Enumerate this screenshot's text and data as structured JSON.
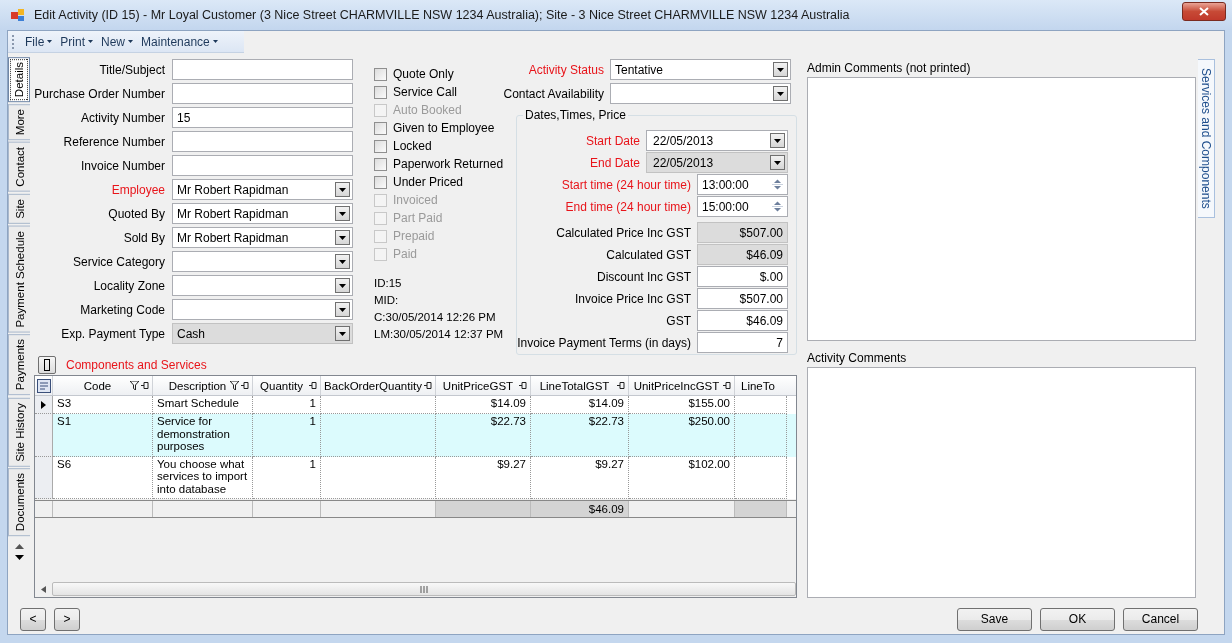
{
  "window": {
    "title": "Edit Activity (ID 15)  - Mr Loyal Customer (3 Nice Street CHARMVILLE  NSW 1234 Australia); Site - 3 Nice Street CHARMVILLE  NSW 1234 Australia"
  },
  "menu": [
    "File",
    "Print",
    "New",
    "Maintenance"
  ],
  "side_tabs": [
    {
      "label": "Details",
      "selected": true
    },
    {
      "label": "More",
      "selected": false
    },
    {
      "label": "Contact",
      "selected": false
    },
    {
      "label": "Site",
      "selected": false
    },
    {
      "label": "Payment Schedule",
      "selected": false
    },
    {
      "label": "Payments",
      "selected": false
    },
    {
      "label": "Site History",
      "selected": false
    },
    {
      "label": "Documents",
      "selected": false
    }
  ],
  "right_tabs": [
    {
      "label": "Services and Components",
      "selected": false
    }
  ],
  "form_fields": [
    {
      "label": "Title/Subject",
      "kind": "text",
      "required": false,
      "disabled": false
    },
    {
      "label": "Purchase Order Number",
      "kind": "text",
      "required": false,
      "disabled": false
    },
    {
      "label": "Activity Number",
      "kind": "text",
      "value": "15",
      "required": false,
      "disabled": false
    },
    {
      "label": "Reference Number",
      "kind": "text",
      "required": false,
      "disabled": false
    },
    {
      "label": "Invoice Number",
      "kind": "text",
      "required": false,
      "disabled": false
    },
    {
      "label": "Employee",
      "kind": "combo",
      "value": "Mr Robert Rapidman",
      "required": true,
      "disabled": false
    },
    {
      "label": "Quoted By",
      "kind": "combo",
      "value": "Mr Robert Rapidman",
      "required": false,
      "disabled": false
    },
    {
      "label": "Sold By",
      "kind": "combo",
      "value": "Mr Robert Rapidman",
      "required": false,
      "disabled": false
    },
    {
      "label": "Service Category",
      "kind": "combo",
      "required": false,
      "disabled": false
    },
    {
      "label": "Locality Zone",
      "kind": "combo",
      "required": false,
      "disabled": false
    },
    {
      "label": "Marketing Code",
      "kind": "combo",
      "required": false,
      "disabled": false
    },
    {
      "label": "Exp. Payment Type",
      "kind": "combo",
      "value": "Cash",
      "required": false,
      "disabled": true
    }
  ],
  "checkboxes": [
    {
      "label": "Quote Only",
      "checked": false,
      "disabled": false
    },
    {
      "label": "Service Call",
      "checked": false,
      "disabled": false
    },
    {
      "label": "Auto Booked",
      "checked": false,
      "disabled": true
    },
    {
      "label": "Given to Employee",
      "checked": false,
      "disabled": false
    },
    {
      "label": "Locked",
      "checked": false,
      "disabled": false
    },
    {
      "label": "Paperwork Returned",
      "checked": false,
      "disabled": false
    },
    {
      "label": "Under Priced",
      "checked": false,
      "disabled": false
    },
    {
      "label": "Invoiced",
      "checked": false,
      "disabled": true
    },
    {
      "label": "Part Paid",
      "checked": false,
      "disabled": true
    },
    {
      "label": "Prepaid",
      "checked": false,
      "disabled": true
    },
    {
      "label": "Paid",
      "checked": false,
      "disabled": true
    }
  ],
  "record_info": [
    "ID:15",
    "MID:",
    "C:30/05/2014 12:26 PM",
    "LM:30/05/2014 12:37 PM"
  ],
  "status_fields": [
    {
      "label": "Activity Status",
      "kind": "combo",
      "value": "Tentative",
      "required": true
    },
    {
      "label": "Contact Availability",
      "kind": "combo",
      "required": false
    }
  ],
  "dates_group": {
    "title": "Dates,Times, Price",
    "fields": [
      {
        "label": "Start Date",
        "kind": "date",
        "value": "22/05/2013",
        "required": true,
        "disabled": false
      },
      {
        "label": "End Date",
        "kind": "date",
        "value": "22/05/2013",
        "required": true,
        "disabled": true
      },
      {
        "label": "Start time (24 hour time)",
        "kind": "time",
        "value": "13:00:00",
        "required": true,
        "disabled": false
      },
      {
        "label": "End time (24 hour time)",
        "kind": "time",
        "value": "15:00:00",
        "required": true,
        "disabled": false
      },
      {
        "label": "Calculated Price Inc GST",
        "kind": "number",
        "value": "$507.00",
        "required": false,
        "disabled": true
      },
      {
        "label": "Calculated GST",
        "kind": "number",
        "value": "$46.09",
        "required": false,
        "disabled": true
      },
      {
        "label": "Discount Inc GST",
        "kind": "number",
        "value": "$.00",
        "required": false,
        "disabled": false
      },
      {
        "label": "Invoice Price Inc GST",
        "kind": "number",
        "value": "$507.00",
        "required": false,
        "disabled": false
      },
      {
        "label": "GST",
        "kind": "number",
        "value": "$46.09",
        "required": false,
        "disabled": false
      },
      {
        "label": "Invoice Payment Terms (in days)",
        "kind": "number",
        "value": "7",
        "required": false,
        "disabled": false
      }
    ]
  },
  "components": {
    "title": "Components and Services",
    "table": {
      "columns": [
        {
          "label": "Code",
          "filter": true
        },
        {
          "label": "Description",
          "filter": true
        },
        {
          "label": "Quantity",
          "filter": false
        },
        {
          "label": "BackOrderQuantity",
          "filter": false
        },
        {
          "label": "UnitPriceGST",
          "filter": false
        },
        {
          "label": "LineTotalGST",
          "filter": false
        },
        {
          "label": "UnitPriceIncGST",
          "filter": false
        },
        {
          "label": "LineTo",
          "filter": false
        }
      ],
      "rows": [
        {
          "cells": [
            "S3",
            "Smart Schedule",
            "1",
            "",
            "$14.09",
            "$14.09",
            "$155.00",
            ""
          ],
          "selected": false,
          "current": true
        },
        {
          "cells": [
            "S1",
            "Service for demonstration purposes",
            "1",
            "",
            "$22.73",
            "$22.73",
            "$250.00",
            ""
          ],
          "selected": true,
          "current": false
        },
        {
          "cells": [
            "S6",
            "You choose what services to import into database",
            "1",
            "",
            "$9.27",
            "$9.27",
            "$102.00",
            ""
          ],
          "selected": false,
          "current": false
        }
      ],
      "summary": {
        "line_total_gst": "$46.09"
      }
    }
  },
  "comments": [
    {
      "label": "Admin Comments (not printed)"
    },
    {
      "label": "Activity Comments"
    }
  ],
  "nav_buttons": [
    "<",
    ">"
  ],
  "buttons": [
    "Save",
    "OK",
    "Cancel"
  ]
}
